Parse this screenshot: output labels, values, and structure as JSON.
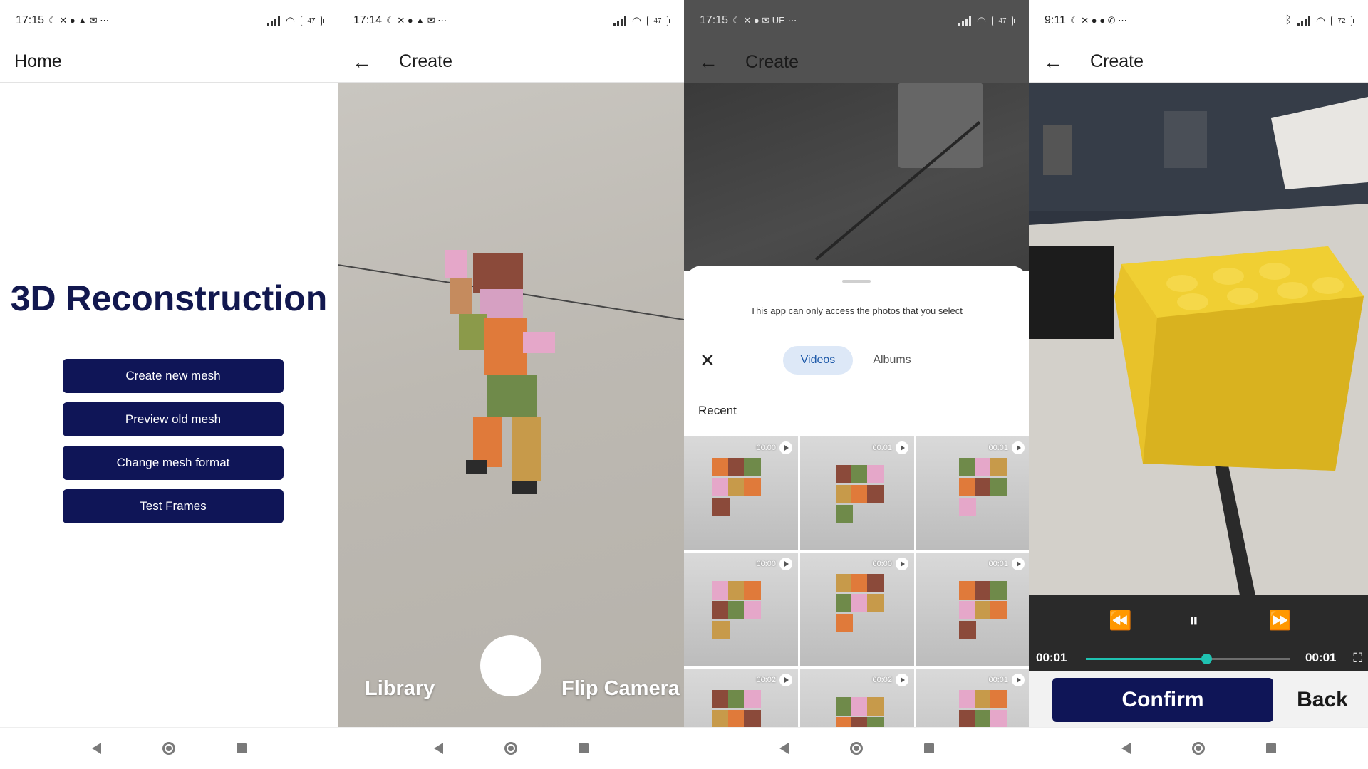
{
  "panels": {
    "home": {
      "status": {
        "time": "17:15",
        "battery": "47"
      },
      "title": "Home",
      "heading": "3D Reconstruction",
      "buttons": [
        "Create new mesh",
        "Preview old mesh",
        "Change mesh format",
        "Test Frames"
      ]
    },
    "camera": {
      "status": {
        "time": "17:14",
        "battery": "47"
      },
      "title": "Create",
      "library_label": "Library",
      "flip_label": "Flip Camera"
    },
    "picker": {
      "status": {
        "time": "17:15",
        "battery": "47"
      },
      "title": "Create",
      "notice": "This app can only access the photos that you select",
      "tabs": {
        "videos": "Videos",
        "albums": "Albums"
      },
      "section_label": "Recent",
      "thumbnails": [
        "00:00",
        "00:01",
        "00:01",
        "00:00",
        "00:00",
        "00:01",
        "00:02",
        "00:02",
        "00:01"
      ]
    },
    "player": {
      "status": {
        "time": "9:11",
        "battery": "72"
      },
      "title": "Create",
      "current_time": "00:01",
      "total_time": "00:01",
      "progress": 0.59,
      "confirm_label": "Confirm",
      "back_label": "Back"
    }
  },
  "icons": {
    "back": "arrow-left-icon",
    "close": "close-icon",
    "rewind": "rewind-icon",
    "pause": "pause-icon",
    "forward": "fast-forward-icon",
    "fullscreen": "fullscreen-icon"
  },
  "colors": {
    "primary": "#0f1557",
    "accent_seek": "#1fc2b1",
    "tab_selected_bg": "#dde8f7",
    "tab_selected_text": "#1c58a8"
  }
}
